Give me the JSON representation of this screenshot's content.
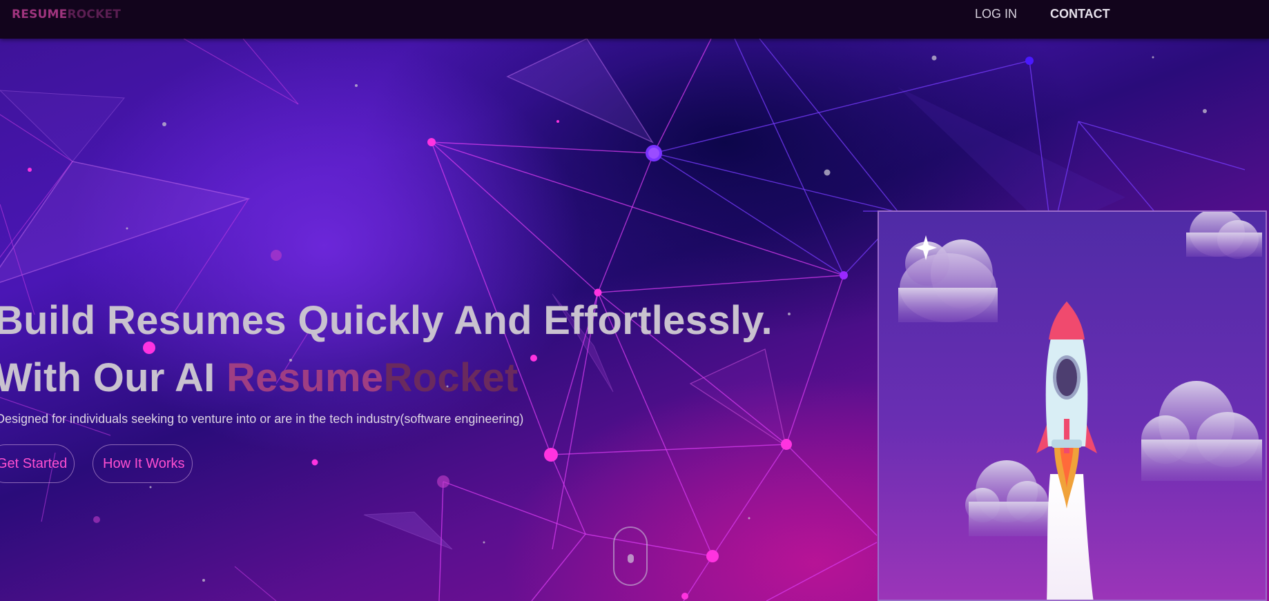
{
  "nav": {
    "logo_part1": "RESUME",
    "logo_part2": "ROCKET",
    "login": "LOG IN",
    "contact": "CONTACT"
  },
  "hero": {
    "headline_line1": "Build Resumes Quickly And Effortlessly.",
    "headline_line2_prefix": "With Our AI ",
    "brand_part1": "Resume",
    "brand_part2": "Rocket",
    "subtitle": "Designed for individuals seeking to venture into or are in the tech industry(software engineering)",
    "get_started": "Get Started",
    "how_it_works": "How It Works"
  },
  "colors": {
    "accent_pink": "#ff4fd0",
    "navbar_bg": "#12041c",
    "logo_pink": "#a0347e",
    "headline_text": "#c9c2cf"
  },
  "icons": {
    "scroll": "scroll-mouse-icon",
    "rocket": "rocket-icon",
    "sparkle": "sparkle-icon",
    "cloud": "cloud-icon"
  }
}
